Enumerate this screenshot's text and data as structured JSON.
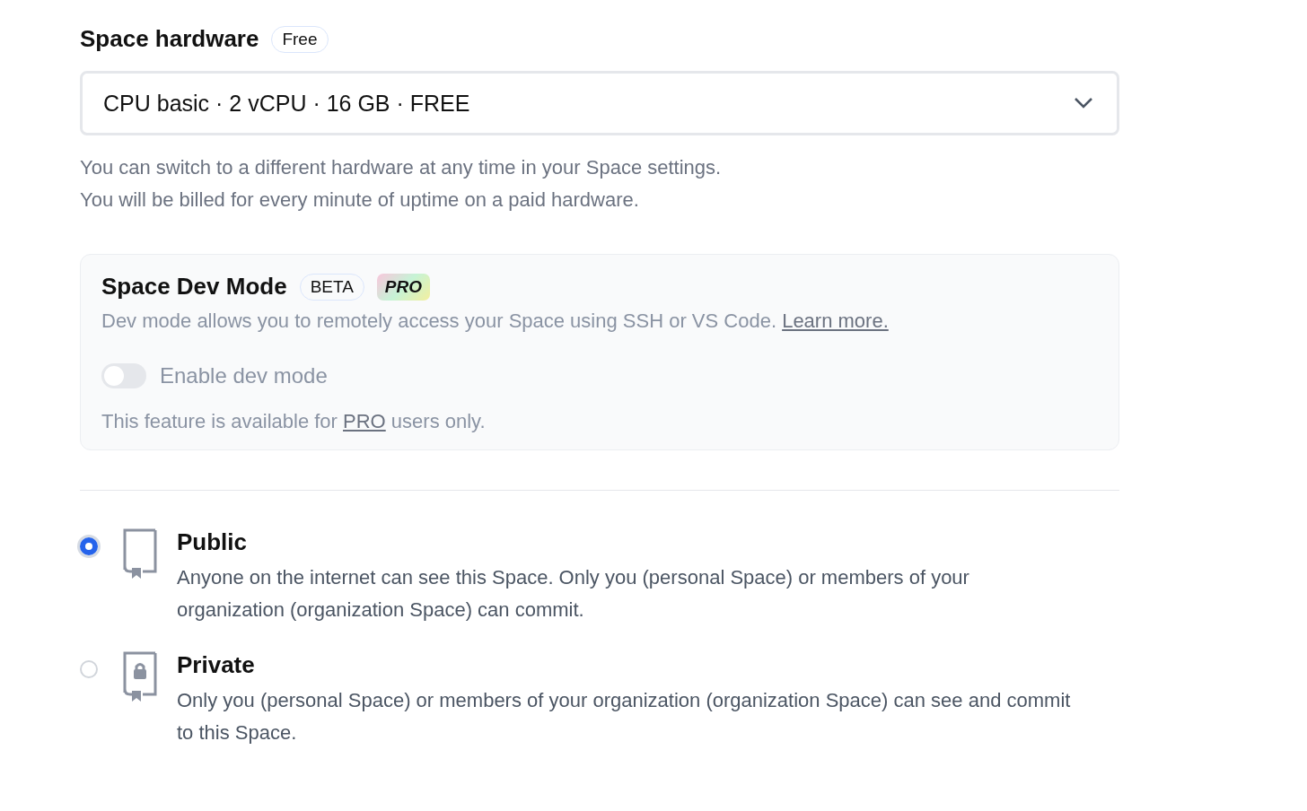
{
  "hardware": {
    "title": "Space hardware",
    "badge": "Free",
    "select_value": "CPU basic · 2 vCPU · 16 GB · FREE",
    "help": [
      "You can switch to a different hardware at any time in your Space settings.",
      "You will be billed for every minute of uptime on a paid hardware."
    ]
  },
  "dev_mode": {
    "title": "Space Dev Mode",
    "badges": [
      {
        "label": "BETA",
        "kind": "outline"
      },
      {
        "label": "PRO",
        "kind": "pro"
      }
    ],
    "description": "Dev mode allows you to remotely access your Space using SSH or VS Code.",
    "link": "Learn more.",
    "toggle": {
      "label": "Enable dev mode",
      "on": false,
      "disabled": true
    },
    "note_before": "This feature is available for",
    "note_link": "PRO",
    "note_after": "users only."
  },
  "visibility": [
    {
      "kind": "public",
      "label": "Public",
      "selected": true,
      "description": "Anyone on the internet can see this Space. Only you (personal Space) or members of your organization (organization Space) can commit."
    },
    {
      "kind": "private",
      "label": "Private",
      "selected": false,
      "description": "Only you (personal Space) or members of your organization (organization Space) can see and commit to this Space."
    }
  ]
}
